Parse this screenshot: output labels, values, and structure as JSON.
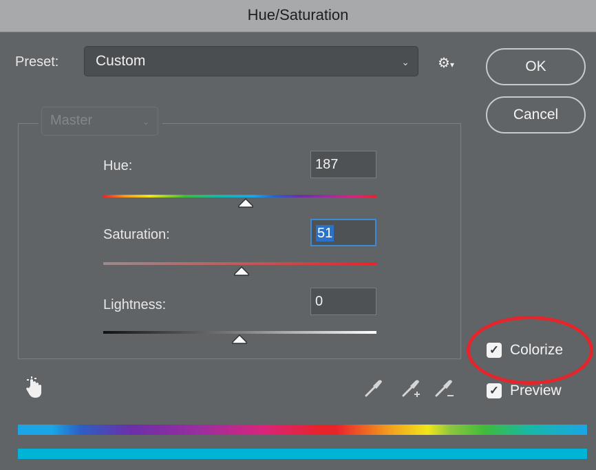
{
  "window": {
    "title": "Hue/Saturation"
  },
  "preset": {
    "label": "Preset:",
    "value": "Custom"
  },
  "buttons": {
    "ok": "OK",
    "cancel": "Cancel"
  },
  "channel": {
    "value": "Master"
  },
  "sliders": {
    "hue": {
      "label": "Hue:",
      "value": "187",
      "position": 0.52
    },
    "saturation": {
      "label": "Saturation:",
      "value": "51",
      "position": 0.5
    },
    "lightness": {
      "label": "Lightness:",
      "value": "0",
      "position": 0.5
    }
  },
  "checkboxes": {
    "colorize": {
      "label": "Colorize",
      "checked": true
    },
    "preview": {
      "label": "Preview",
      "checked": true
    }
  },
  "icons": {
    "gear": "gear-icon",
    "hand": "targeted-adjustment-hand-icon",
    "eyedropper": "eyedropper-icon",
    "eyedropper_add": "eyedropper-plus-icon",
    "eyedropper_subtract": "eyedropper-minus-icon"
  },
  "colors": {
    "highlight_circle": "#e3262c",
    "colorize_result": "#00b4d8",
    "selection": "#2a72c9"
  }
}
